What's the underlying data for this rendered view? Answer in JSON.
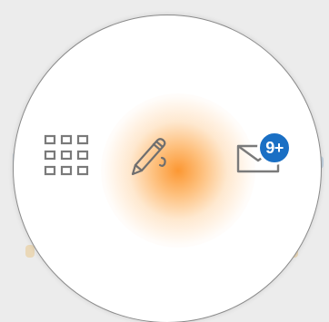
{
  "radial_menu": {
    "items": [
      {
        "id": "apps",
        "icon": "grid-icon"
      },
      {
        "id": "compose",
        "icon": "pencil-icon",
        "highlighted": true
      },
      {
        "id": "mail",
        "icon": "envelope-icon",
        "badge": "9+"
      }
    ]
  },
  "colors": {
    "badge_bg": "#1a6fc4",
    "icon_gray": "#7a7a7a",
    "glow": "#fc9228",
    "ring_border": "#8a8a8a"
  }
}
